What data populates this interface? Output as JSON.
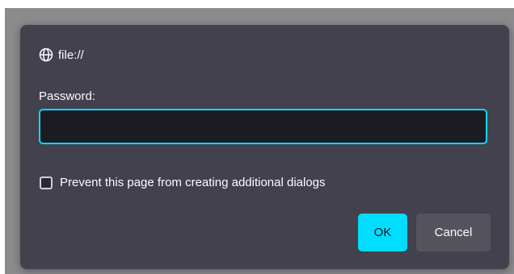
{
  "dialog": {
    "origin": "file://",
    "origin_icon": "globe-icon",
    "password_label": "Password:",
    "password_value": "",
    "checkbox_label": "Prevent this page from creating additional dialogs",
    "checkbox_checked": false,
    "ok_label": "OK",
    "cancel_label": "Cancel"
  },
  "colors": {
    "accent": "#00ddff",
    "dialog_bg": "#42414d",
    "input_bg": "#1c1b22",
    "text": "#fbfbfe"
  }
}
